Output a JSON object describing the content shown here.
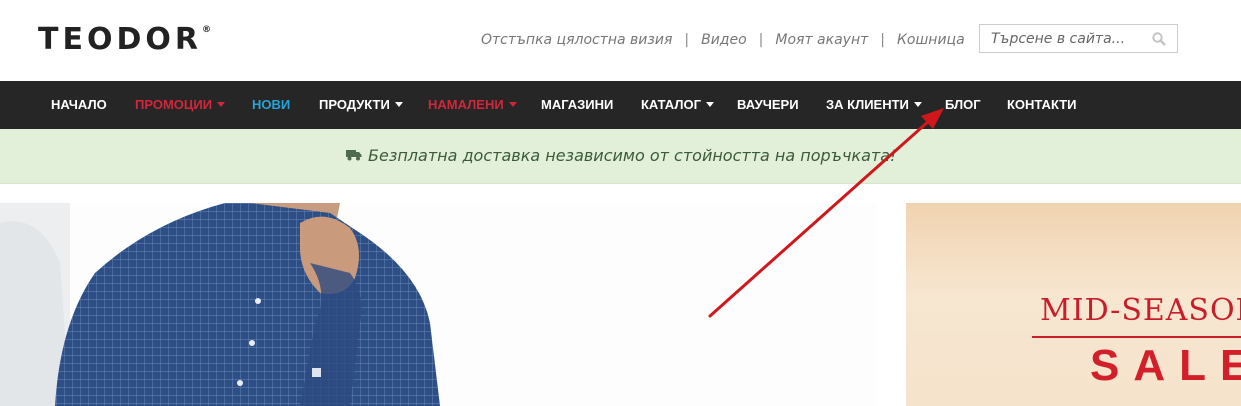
{
  "header": {
    "logo": "TEODOR",
    "logo_mark": "®",
    "links": [
      "Отстъпка цялостна визия",
      "Видео",
      "Моят акаунт",
      "Кошница"
    ],
    "search_placeholder": "Търсене в сайта..."
  },
  "nav": {
    "items": [
      {
        "label": "НАЧАЛО",
        "dropdown": false,
        "color": "#ffffff"
      },
      {
        "label": "ПРОМОЦИИ",
        "dropdown": true,
        "color": "#d1263b"
      },
      {
        "label": "НОВИ",
        "dropdown": false,
        "color": "#28a3d8"
      },
      {
        "label": "ПРОДУКТИ",
        "dropdown": true,
        "color": "#ffffff"
      },
      {
        "label": "НАМАЛЕНИ",
        "dropdown": true,
        "color": "#d1263b"
      },
      {
        "label": "МАГАЗИНИ",
        "dropdown": false,
        "color": "#ffffff"
      },
      {
        "label": "КАТАЛОГ",
        "dropdown": true,
        "color": "#ffffff"
      },
      {
        "label": "ВАУЧЕРИ",
        "dropdown": false,
        "color": "#ffffff"
      },
      {
        "label": "ЗА КЛИЕНТИ",
        "dropdown": true,
        "color": "#ffffff"
      },
      {
        "label": "БЛОГ",
        "dropdown": false,
        "color": "#ffffff"
      },
      {
        "label": "КОНТАКТИ",
        "dropdown": false,
        "color": "#ffffff"
      }
    ]
  },
  "banner": {
    "text": "Безплатна доставка независимо от стойността на поръчката!",
    "icon": "truck-icon"
  },
  "promo": {
    "line1": "MID-SEASON",
    "line2": "SALE"
  },
  "annotation": {
    "arrow_color": "#d0181c"
  }
}
